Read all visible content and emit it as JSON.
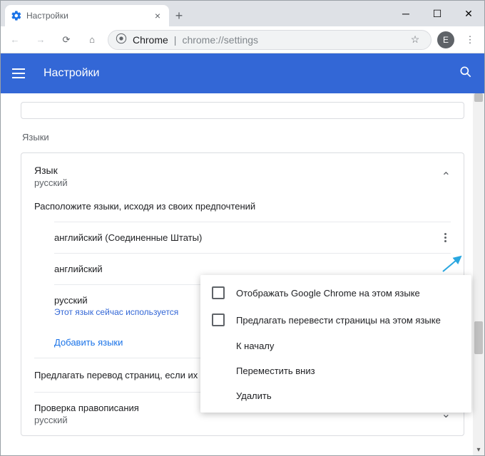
{
  "window": {
    "tab_title": "Настройки",
    "new_tab": "+"
  },
  "toolbar": {
    "url_label": "Chrome",
    "url_sep": " | ",
    "url_path": "chrome://settings",
    "avatar_letter": "E"
  },
  "header": {
    "title": "Настройки"
  },
  "sections": {
    "languages_label": "Языки"
  },
  "lang_card": {
    "title": "Язык",
    "current": "русский",
    "hint": "Расположите языки, исходя из своих предпочтений",
    "rows": [
      {
        "name": "английский (Соединенные Штаты)",
        "sub": ""
      },
      {
        "name": "английский",
        "sub": ""
      },
      {
        "name": "русский",
        "sub": "Этот язык сейчас используется"
      }
    ],
    "add": "Добавить языки",
    "translate": "Предлагать перевод страниц, если их",
    "spell_title": "Проверка правописания",
    "spell_sub": "русский"
  },
  "popup": {
    "opt_display": "Отображать Google Chrome на этом языке",
    "opt_offer": "Предлагать перевести страницы на этом языке",
    "to_top": "К началу",
    "move_down": "Переместить вниз",
    "delete": "Удалить"
  }
}
